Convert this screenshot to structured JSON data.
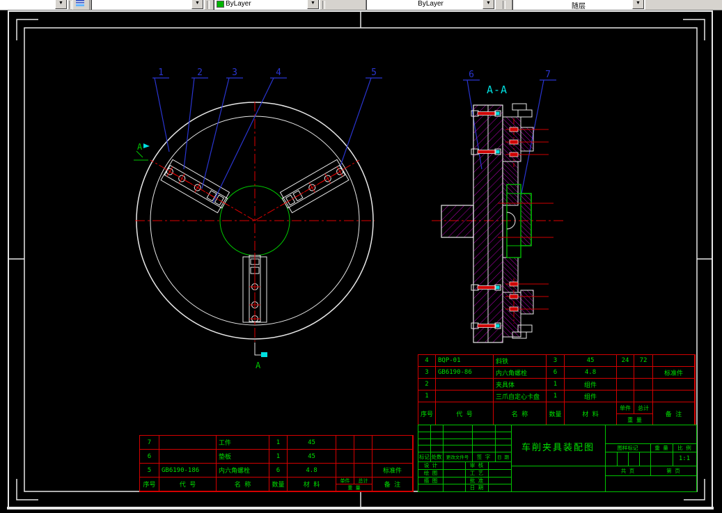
{
  "toolbar": {
    "color_value": "ByLayer",
    "linetype_value": "ByLayer",
    "lineweight_value": "随层"
  },
  "drawing": {
    "section_title": "A-A",
    "cut_label": "A",
    "callouts": [
      "1",
      "2",
      "3",
      "4",
      "5",
      "6",
      "7"
    ]
  },
  "colors": {
    "frame_white": "#e8e8e8",
    "table_red": "#d40000",
    "text_green": "#00e000",
    "grid_green": "#00c400",
    "leader_blue": "#2a35d0",
    "hatch_magenta": "#b800b8",
    "cyan": "#00e0e0"
  },
  "bom_headers": {
    "no": "序号",
    "code": "代  号",
    "name": "名  称",
    "qty": "数量",
    "material": "材  料",
    "unit": "单件",
    "total": "总计",
    "weight": "重 量",
    "note": "备  注"
  },
  "bom_upper": {
    "rows": [
      {
        "no": "4",
        "code": "BQP-01",
        "name": "斜铁",
        "qty": "3",
        "material": "45",
        "unit": "24",
        "total": "72",
        "note": ""
      },
      {
        "no": "3",
        "code": "GB6190-86",
        "name": "内六角螺栓",
        "qty": "6",
        "material": "4.8",
        "unit": "",
        "total": "",
        "note": "标准件"
      },
      {
        "no": "2",
        "code": "",
        "name": "夹具体",
        "qty": "1",
        "material": "组件",
        "unit": "",
        "total": "",
        "note": ""
      },
      {
        "no": "1",
        "code": "",
        "name": "三爪自定心卡盘",
        "qty": "1",
        "material": "组件",
        "unit": "",
        "total": "",
        "note": ""
      }
    ]
  },
  "bom_lower": {
    "rows": [
      {
        "no": "7",
        "code": "",
        "name": "工件",
        "qty": "1",
        "material": "45",
        "unit": "",
        "total": "",
        "note": ""
      },
      {
        "no": "6",
        "code": "",
        "name": "垫板",
        "qty": "1",
        "material": "45",
        "unit": "",
        "total": "",
        "note": ""
      },
      {
        "no": "5",
        "code": "GB6190-186",
        "name": "内六角螺栓",
        "qty": "6",
        "material": "4.8",
        "unit": "",
        "total": "",
        "note": "标准件"
      }
    ]
  },
  "titleblock": {
    "title": "车削夹具装配图",
    "rev_cols": [
      "标记",
      "处数",
      "更改文件号",
      "签 字",
      "日 期"
    ],
    "sign_left": [
      "设 计",
      "绘 图",
      "描 图"
    ],
    "sign_right": [
      "审 核",
      "工 艺",
      "批 准",
      "日 期"
    ],
    "stamp_cols": [
      "图样标记",
      "重 量",
      "比 例"
    ],
    "scale": "1:1",
    "sheet_total": "共  页",
    "sheet_no": "第  页"
  }
}
